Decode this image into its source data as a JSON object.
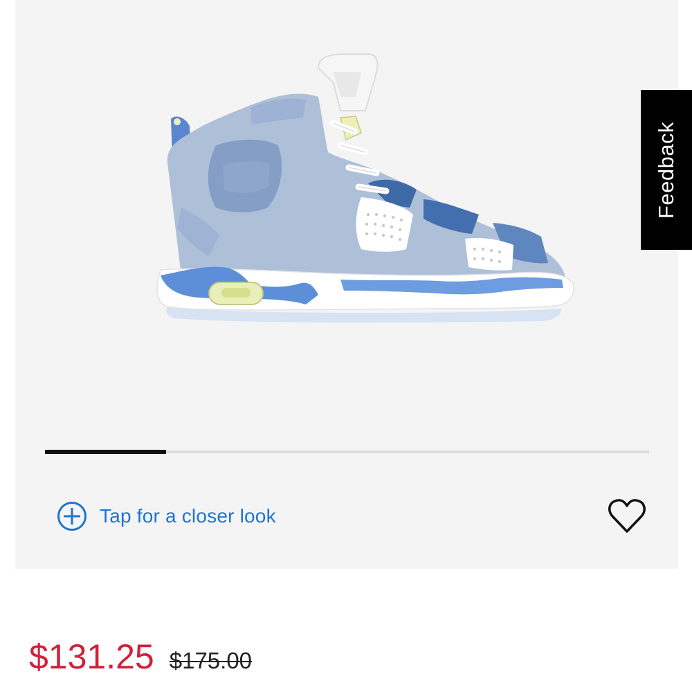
{
  "product": {
    "image_alt": "Air Jordan 6 Retro sneaker in washed denim blue with white leather and light blue midsole"
  },
  "gallery": {
    "progress_fraction": 0.2,
    "closer_look_label": "Tap for a closer look",
    "icons": {
      "zoom": "plus-circle-icon",
      "favorite": "heart-icon"
    }
  },
  "feedback": {
    "label": "Feedback"
  },
  "pricing": {
    "sale_price": "$131.25",
    "original_price": "$175.00"
  },
  "colors": {
    "accent_blue": "#1f74d1",
    "sale_red": "#d0203a",
    "gallery_bg": "#f4f4f4",
    "feedback_bg": "#000000"
  }
}
